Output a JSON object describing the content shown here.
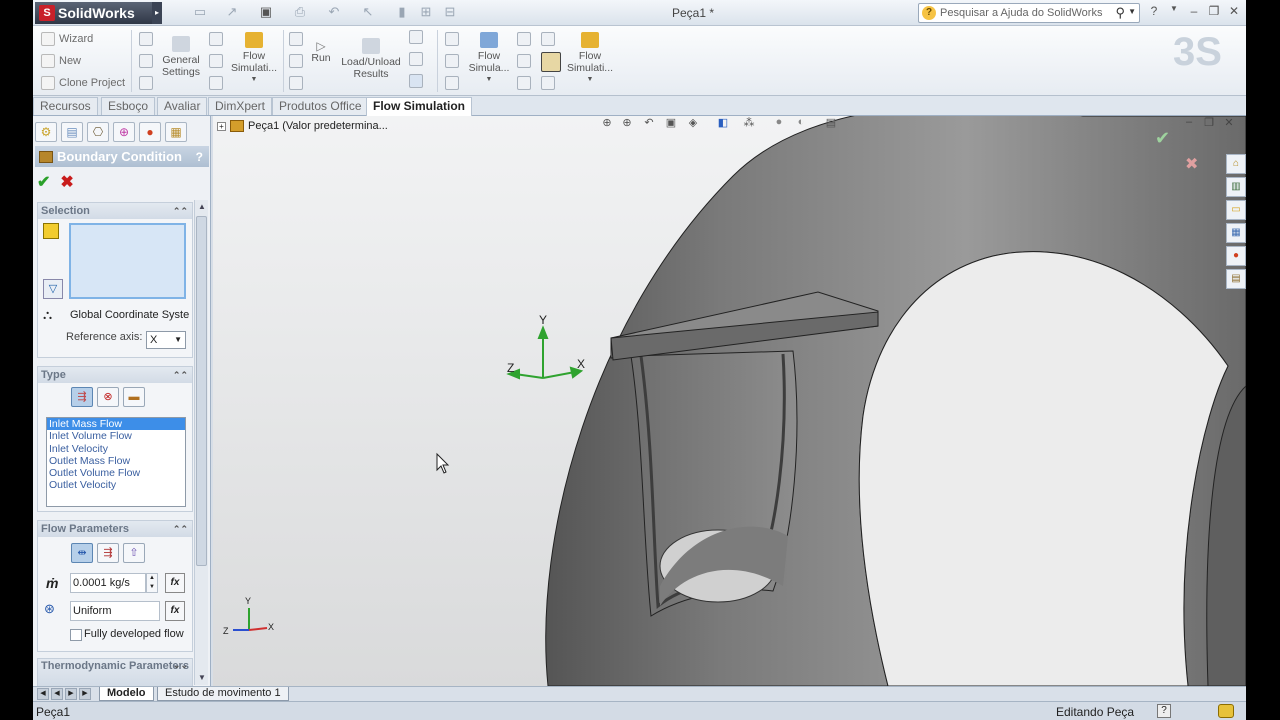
{
  "app": {
    "name": "SolidWorks",
    "doc_title": "Peça1 *",
    "search_placeholder": "Pesquisar a Ajuda do SolidWorks"
  },
  "ribbon": {
    "wizard": "Wizard",
    "new": "New",
    "clone_project": "Clone Project",
    "general_settings": "General Settings",
    "flow_simulation_1": "Flow Simulati...",
    "run": "Run",
    "load_unload_results": "Load/Unload Results",
    "flow_simulation_2": "Flow Simula...",
    "flow_simulation_3": "Flow Simulati..."
  },
  "command_tabs": [
    "Recursos",
    "Esboço",
    "Avaliar",
    "DimXpert",
    "Produtos Office",
    "Flow Simulation"
  ],
  "property_manager": {
    "title": "Boundary Condition",
    "help": "?",
    "selection": {
      "header": "Selection",
      "coordinate_system": "Global Coordinate Syste",
      "reference_axis_label": "Reference axis:",
      "reference_axis_value": "X"
    },
    "type": {
      "header": "Type",
      "options": [
        "Inlet Mass Flow",
        "Inlet Volume Flow",
        "Inlet Velocity",
        "Outlet Mass Flow",
        "Outlet Volume Flow",
        "Outlet Velocity"
      ],
      "selected": "Inlet Mass Flow"
    },
    "flow_parameters": {
      "header": "Flow Parameters",
      "mass_flow_symbol": "ṁ",
      "mass_flow_value": "0.0001 kg/s",
      "profile_value": "Uniform",
      "fully_developed_label": "Fully developed flow",
      "fx": "fx"
    },
    "thermo_header": "Thermodynamic Parameters"
  },
  "viewport": {
    "tree_node": "Peça1  (Valor predetermina...",
    "triad_main": {
      "x": "X",
      "y": "Y",
      "z": "Z"
    },
    "triad_corner": {
      "x": "X",
      "y": "Y",
      "z": "Z"
    }
  },
  "model_tabs": [
    "Modelo",
    "Estudo de movimento 1"
  ],
  "status": {
    "left": "Peça1",
    "right": "Editando Peça",
    "help": "?"
  },
  "colors": {
    "active_list_item": "#3d8ee8",
    "ok_check": "#2aa02a",
    "cancel_x": "#c81c1c",
    "axis_green": "#2fa32f"
  }
}
